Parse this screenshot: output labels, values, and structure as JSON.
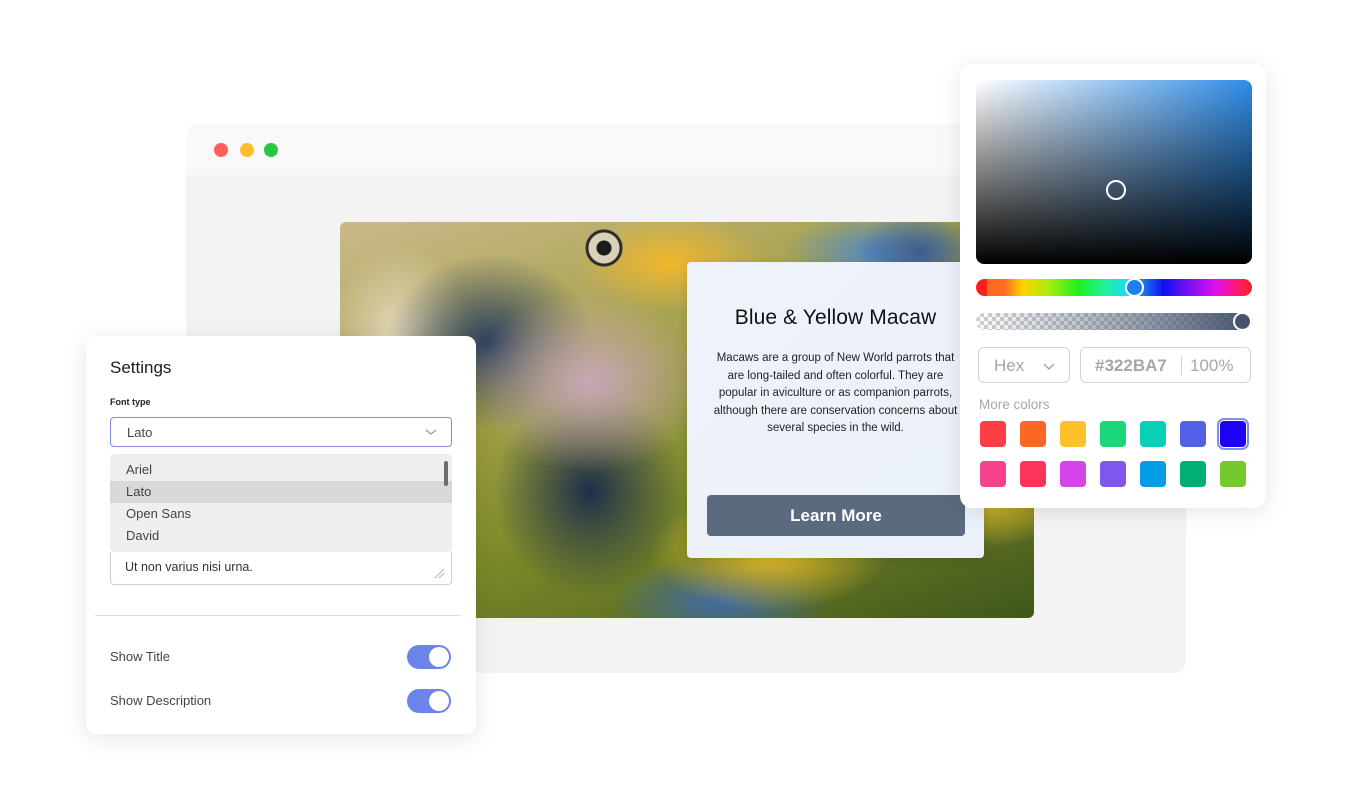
{
  "browser": {
    "window_controls": [
      "close",
      "minimize",
      "maximize"
    ]
  },
  "card": {
    "title": "Blue & Yellow Macaw",
    "description": "Macaws are a group of New World parrots that are long-tailed and often colorful. They are popular in aviculture or as companion parrots, although there are conservation concerns about several species in the wild.",
    "button_label": "Learn More",
    "button_color": "#5a6a7f"
  },
  "settings": {
    "title": "Settings",
    "font_label": "Font type",
    "font_selected": "Lato",
    "font_options": [
      "Ariel",
      "Lato",
      "Open Sans",
      "David"
    ],
    "textarea_value": "Ut non varius nisi urna.",
    "toggles": [
      {
        "label": "Show Title",
        "on": true
      },
      {
        "label": "Show Description",
        "on": true
      }
    ],
    "accent_color": "#6b84ea"
  },
  "color_picker": {
    "format": "Hex",
    "hex_value": "#322BA7",
    "alpha_value": "100%",
    "more_colors_label": "More colors",
    "swatches": [
      [
        "#fe3d44",
        "#fe6624",
        "#ffc12a",
        "#1ad87a",
        "#08d0b8",
        "#5360e6",
        "#1d00f5"
      ],
      [
        "#f6418e",
        "#fd3359",
        "#d544e8",
        "#7f56ee",
        "#039de3",
        "#01ae76",
        "#74c92c"
      ]
    ],
    "selected_swatch": "#1d00f5"
  }
}
